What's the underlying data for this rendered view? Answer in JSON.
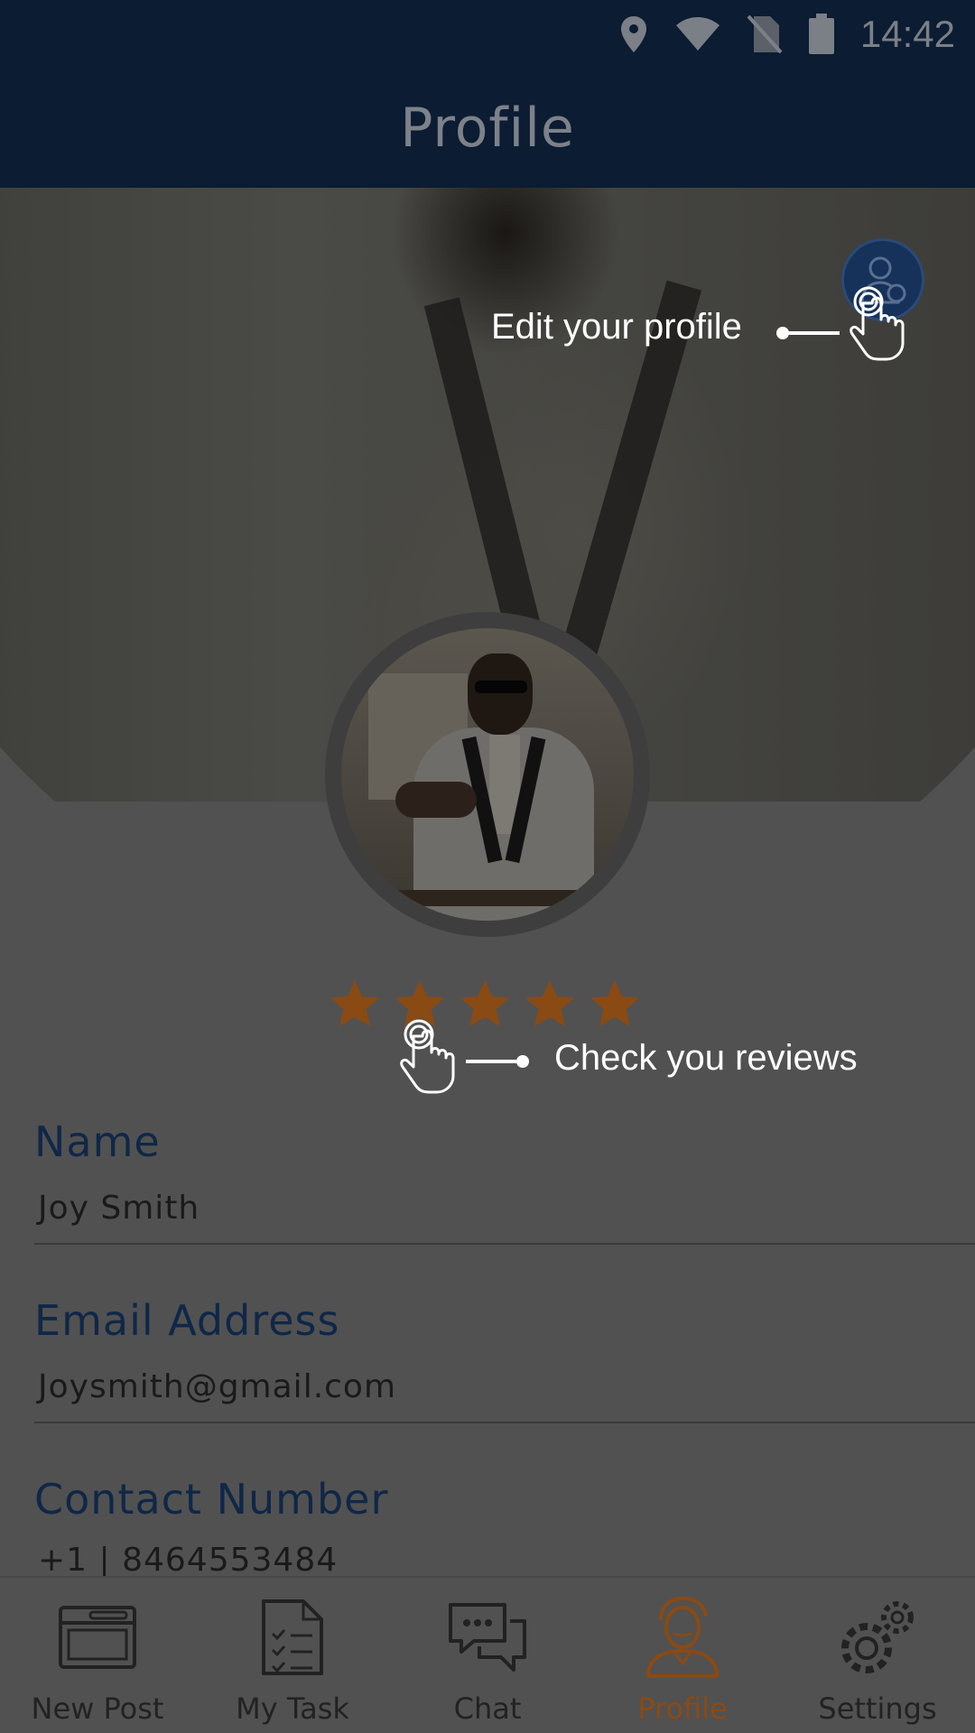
{
  "status_bar": {
    "time": "14:42",
    "icons": [
      "location-icon",
      "wifi-icon",
      "no-sim-icon",
      "battery-icon"
    ]
  },
  "header": {
    "title": "Profile"
  },
  "coach_marks": {
    "edit_profile": "Edit your profile",
    "reviews": "Check you reviews"
  },
  "rating": {
    "stars": 5,
    "max": 5,
    "color": "#8a4a14"
  },
  "profile": {
    "name_label": "Name",
    "name_value": "Joy Smith",
    "email_label": "Email Address",
    "email_value": "Joysmith@gmail.com",
    "contact_label": "Contact Number",
    "contact_value": "+1 | 8464553484"
  },
  "tabs": [
    {
      "label": "New Post",
      "icon": "new-post-icon"
    },
    {
      "label": "My Task",
      "icon": "task-list-icon"
    },
    {
      "label": "Chat",
      "icon": "chat-icon"
    },
    {
      "label": "Profile",
      "icon": "profile-icon",
      "active": true
    },
    {
      "label": "Settings",
      "icon": "settings-icon"
    }
  ],
  "colors": {
    "header_bg": "#0b1c33",
    "overlay_bg": "#515151",
    "accent": "#8a4a14",
    "label_blue": "#0f2748"
  }
}
